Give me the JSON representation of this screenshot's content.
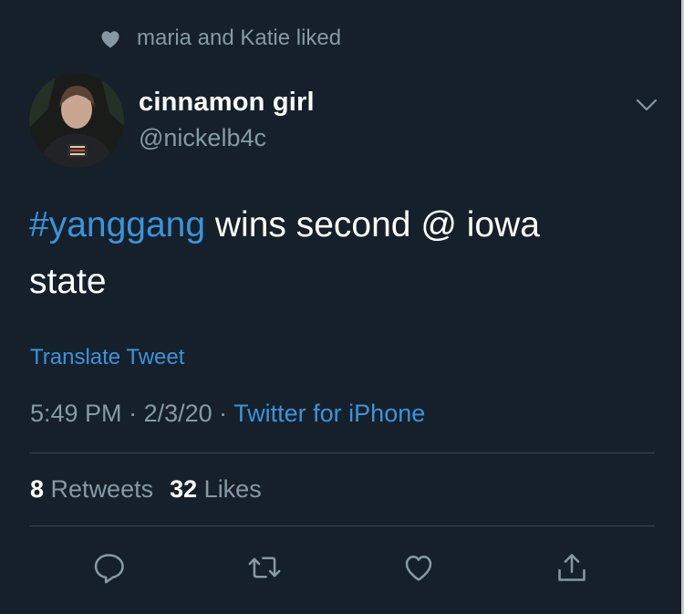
{
  "social_context": {
    "text": "maria and Katie liked",
    "icon": "heart-icon"
  },
  "author": {
    "display_name": "cinnamon girl",
    "handle": "@nickelb4c"
  },
  "tweet": {
    "hashtag": "#yanggang",
    "text_line1_rest": " wins second @ iowa",
    "text_line2": "state"
  },
  "translate_label": "Translate Tweet",
  "meta": {
    "time": "5:49 PM",
    "sep1": " · ",
    "date": "2/3/20",
    "sep2": " · ",
    "source": "Twitter for iPhone"
  },
  "stats": {
    "retweets_count": "8",
    "retweets_label": "Retweets",
    "likes_count": "32",
    "likes_label": "Likes"
  },
  "colors": {
    "background": "#15202b",
    "accent": "#3b94d9",
    "muted": "#8899a6",
    "divider": "#38444d"
  },
  "actions": [
    "reply-icon",
    "retweet-icon",
    "like-icon",
    "share-icon"
  ]
}
